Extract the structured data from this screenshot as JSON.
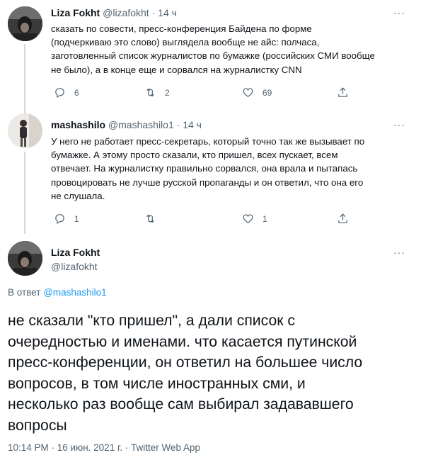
{
  "tweets": [
    {
      "name": "Liza Fokht",
      "handle": "@lizafokht",
      "separator": "·",
      "time": "14 ч",
      "more": "···",
      "text": "сказать по совести, пресс-конференция Байдена по форме\n(подчеркиваю это слово) выглядела вообще не айс: полчаса,\nзаготовленный список журналистов по бумажке (российских СМИ вообще\nне было), а в конце еще и сорвался на журналистку CNN",
      "actions": {
        "reply_count": "6",
        "retweet_count": "2",
        "like_count": "69"
      }
    },
    {
      "name": "mashashilo",
      "handle": "@mashashilo1",
      "separator": "·",
      "time": "14 ч",
      "more": "···",
      "text": "У него не работает пресс-секретарь, который точно так же вызывает по\nбумажке. А этому просто сказали, кто пришел, всех пускает, всем\nотвечает. На журналистку правильно сорвался, она врала и пытапась\nпровоцировать не лучше русской пропаганды и он ответил, что она его\nне слушала.",
      "actions": {
        "reply_count": "1",
        "retweet_count": "",
        "like_count": "1"
      }
    }
  ],
  "focus_tweet": {
    "name": "Liza Fokht",
    "handle": "@lizafokht",
    "more": "···",
    "reply_to_prefix": "В ответ",
    "reply_to_handle": "@mashashilo1",
    "text": "не сказали \"кто пришел\", а дали список с\nочередностью и именами. что касается путинской\nпресс-конференции, он ответил на большее число\nвопросов, в том числе иностранных сми, и\nнесколько раз вообще сам выбирал задававшего\nвопросы",
    "meta": "10:14 PM · 16 июн. 2021 г. · Twitter Web App"
  },
  "colors": {
    "text": "#0f1419",
    "secondary": "#536471",
    "link": "#1d9bf0",
    "thread_line": "#cfd9de"
  }
}
